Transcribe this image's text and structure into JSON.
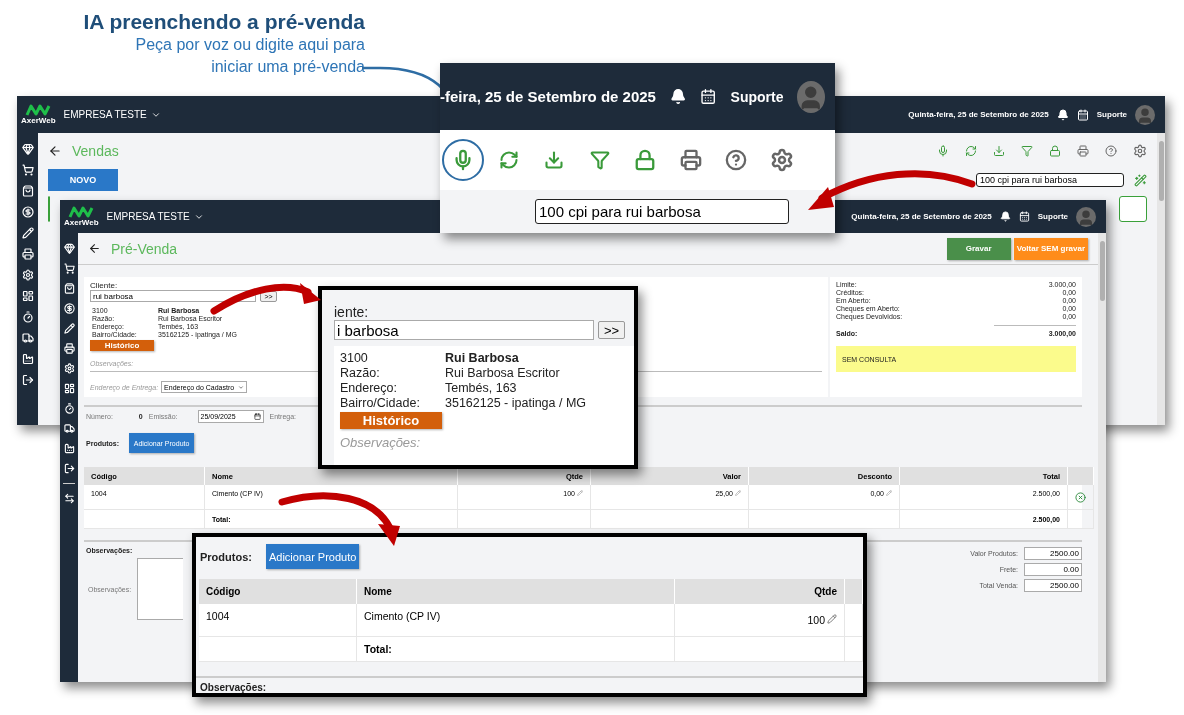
{
  "callout": {
    "title": "IA preenchendo a pré-venda",
    "lines": [
      "Peça por voz ou digite aqui para",
      "iniciar uma pré-venda"
    ]
  },
  "back_window": {
    "logo": "AxerWeb",
    "company": "EMPRESA TESTE",
    "date": "Quinta-feira, 25 de Setembro de 2025",
    "user": "Suporte",
    "page_title": "Vendas",
    "new_button": "NOVO",
    "command": {
      "value": "100 cpi para rui barbosa"
    }
  },
  "toolbar_zoom": {
    "date": "-feira, 25 de Setembro de 2025",
    "user": "Suporte",
    "command": {
      "value": "100 cpi para rui barbosa"
    }
  },
  "front_window": {
    "logo": "AxerWeb",
    "company": "EMPRESA TESTE",
    "date": "Quinta-feira, 25 de Setembro de 2025",
    "user": "Suporte",
    "page_title": "Pré-Venda",
    "actions": [
      {
        "label": "Gravar",
        "kind": "save"
      },
      {
        "label": "Voltar SEM gravar",
        "kind": "back"
      }
    ],
    "client": {
      "label": "Cliente:",
      "value": "rui barbosa",
      "go": ">>",
      "code": "3100",
      "name": "Rui Barbosa",
      "fields": [
        {
          "label": "Razão:",
          "value": "Rui Barbosa Escritor"
        },
        {
          "label": "Endereço:",
          "value": "Tembés, 163"
        },
        {
          "label": "Bairro/Cidade:",
          "value": "35162125 - ipatinga / MG"
        }
      ],
      "history": "Histórico",
      "notes_label": "Observações:",
      "delivery_label": "Endereço de Entrega:",
      "delivery_value": "Endereço do Cadastro"
    },
    "credit": {
      "rows": [
        {
          "label": "Limite:",
          "value": "3.000,00"
        },
        {
          "label": "Créditos:",
          "value": "0,00"
        },
        {
          "label": "Em Aberto:",
          "value": "0,00"
        },
        {
          "label": "Cheques em Aberto:",
          "value": "0,00"
        },
        {
          "label": "Cheques Devolvidos:",
          "value": "0,00"
        }
      ],
      "balance_label": "Saldo:",
      "balance": "3.000,00",
      "status": "SEM CONSULTA"
    },
    "order": {
      "number_label": "Número:",
      "number": "0",
      "issue_label": "Emissão:",
      "issue": "25/09/2025",
      "delivery_label": "Entrega:"
    },
    "products": {
      "label": "Produtos:",
      "add": "Adicionar Produto",
      "columns": [
        "Código",
        "Nome",
        "Qtde",
        "Valor",
        "Desconto",
        "Total"
      ],
      "rows": [
        {
          "cells": [
            "1004",
            "Cimento (CP IV)",
            "100",
            "25,00",
            "0,00",
            "2.500,00"
          ]
        }
      ],
      "total_label": "Total:",
      "total": "2.500,00"
    },
    "notes": {
      "label": "Observações:",
      "field_label": "Observações:"
    },
    "totals": [
      {
        "label": "Valor Produtos:",
        "value": "2500.00"
      },
      {
        "label": "Frete:",
        "value": "0.00"
      },
      {
        "label": "Total Venda:",
        "value": "2500.00"
      }
    ]
  },
  "client_zoom": {
    "label": "iente:",
    "value": "i barbosa",
    "go": ">>",
    "code": "3100",
    "name": "Rui Barbosa",
    "fields": [
      {
        "label": "Razão:",
        "value": "Rui Barbosa Escritor"
      },
      {
        "label": "Endereço:",
        "value": "Tembés, 163"
      },
      {
        "label": "Bairro/Cidade:",
        "value": "35162125 - ipatinga / MG"
      }
    ],
    "history": "Histórico",
    "notes_label": "Observações:"
  },
  "products_zoom": {
    "label": "Produtos:",
    "add": "Adicionar Produto",
    "columns": [
      "Código",
      "Nome",
      "Qtde"
    ],
    "rows": [
      {
        "cells": [
          "1004",
          "Cimento (CP IV)",
          "100"
        ]
      }
    ],
    "total_label": "Total:",
    "notes_label": "Observações:"
  }
}
